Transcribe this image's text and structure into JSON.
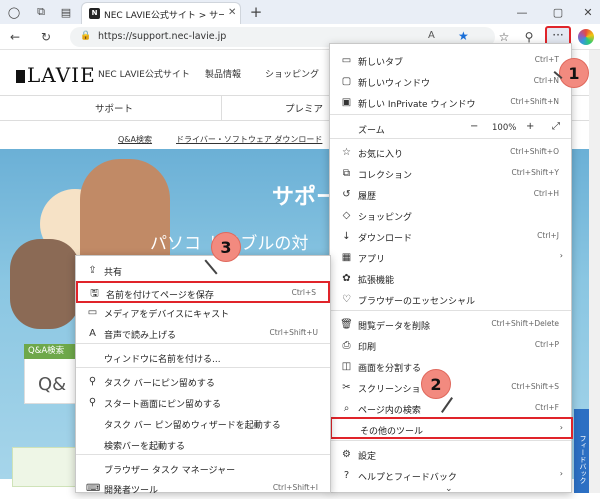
{
  "tab": {
    "title": "NEC LAVIE公式サイト > サービス＆サ",
    "favicon": "N"
  },
  "address": {
    "url": "https://support.nec-lavie.jp"
  },
  "site": {
    "logo": "LAVIE",
    "brand": "NEC LAVIE公式サイト",
    "nav": [
      "製品情報",
      "ショッピング"
    ],
    "subnav": [
      "サポート",
      "プレミア"
    ],
    "links": [
      "Q&A検索",
      "ドライバー・ソフトウェア ダウンロード"
    ],
    "hero_title": "サポー",
    "hero_sub": "パソコ  トラブルの対",
    "qa_tag": "Q&A検索",
    "qa_text": "Q&",
    "feedback": "フィードバック"
  },
  "main_menu": {
    "items": [
      {
        "icon": "▭",
        "label": "新しいタブ",
        "shortcut": "Ctrl+T"
      },
      {
        "icon": "▢",
        "label": "新しいウィンドウ",
        "shortcut": "Ctrl+N"
      },
      {
        "icon": "▣",
        "label": "新しい InPrivate ウィンドウ",
        "shortcut": "Ctrl+Shift+N"
      },
      {
        "label": "ズーム",
        "zoom": "100%"
      },
      {
        "icon": "☆",
        "label": "お気に入り",
        "shortcut": "Ctrl+Shift+O"
      },
      {
        "icon": "⧉",
        "label": "コレクション",
        "shortcut": "Ctrl+Shift+Y"
      },
      {
        "icon": "↺",
        "label": "履歴",
        "shortcut": "Ctrl+H"
      },
      {
        "icon": "◇",
        "label": "ショッピング",
        "shortcut": ""
      },
      {
        "icon": "↓",
        "label": "ダウンロード",
        "shortcut": "Ctrl+J"
      },
      {
        "icon": "▦",
        "label": "アプリ",
        "shortcut": "",
        "arrow": "›"
      },
      {
        "icon": "✿",
        "label": "拡張機能",
        "shortcut": ""
      },
      {
        "icon": "♡",
        "label": "ブラウザーのエッセンシャル",
        "shortcut": ""
      },
      {
        "icon": "🗑",
        "label": "閲覧データを削除",
        "shortcut": "Ctrl+Shift+Delete"
      },
      {
        "icon": "⎙",
        "label": "印刷",
        "shortcut": "Ctrl+P"
      },
      {
        "icon": "◫",
        "label": "画面を分割する",
        "shortcut": ""
      },
      {
        "icon": "✂",
        "label": "スクリーンショット",
        "shortcut": "Ctrl+Shift+S"
      },
      {
        "icon": "⌕",
        "label": "ページ内の検索",
        "shortcut": "Ctrl+F"
      },
      {
        "icon": "",
        "label": "その他のツール",
        "shortcut": "",
        "arrow": "›"
      },
      {
        "icon": "⚙",
        "label": "設定",
        "shortcut": ""
      },
      {
        "icon": "?",
        "label": "ヘルプとフィードバック",
        "shortcut": "",
        "arrow": "›"
      }
    ],
    "zoom_minus": "−",
    "zoom_plus": "+",
    "zoom_full": "⤢",
    "more": "⌄"
  },
  "sub_menu": {
    "items": [
      {
        "icon": "⇪",
        "label": "共有",
        "shortcut": ""
      },
      {
        "icon": "🖫",
        "label": "名前を付けてページを保存",
        "shortcut": "Ctrl+S"
      },
      {
        "icon": "▭",
        "label": "メディアをデバイスにキャスト",
        "shortcut": ""
      },
      {
        "icon": "A",
        "label": "音声で読み上げる",
        "shortcut": "Ctrl+Shift+U"
      },
      {
        "icon": "",
        "label": "ウィンドウに名前を付ける...",
        "shortcut": ""
      },
      {
        "icon": "⚲",
        "label": "タスク バーにピン留めする",
        "shortcut": ""
      },
      {
        "icon": "⚲",
        "label": "スタート画面にピン留めする",
        "shortcut": ""
      },
      {
        "icon": "",
        "label": "タスク バー ピン留めウィザードを起動する",
        "shortcut": ""
      },
      {
        "icon": "",
        "label": "検索バーを起動する",
        "shortcut": ""
      },
      {
        "icon": "",
        "label": "ブラウザー タスク マネージャー",
        "shortcut": ""
      },
      {
        "icon": "⌨",
        "label": "開発者ツール",
        "shortcut": "Ctrl+Shift+I"
      }
    ]
  },
  "badges": [
    "1",
    "2",
    "3"
  ],
  "colors": {
    "highlight": "#e0242a",
    "badge": "#f28a7f"
  }
}
